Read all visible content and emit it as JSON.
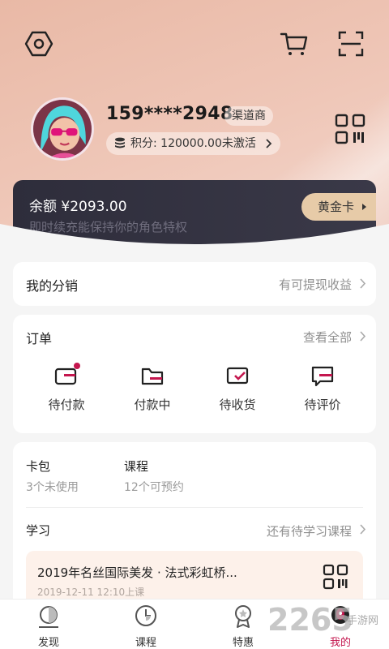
{
  "profile": {
    "phone": "159****2948",
    "badge": "渠道商",
    "points": "积分: 120000.00未激活"
  },
  "balance": {
    "amount": "余额 ¥2093.00",
    "subtitle": "即时续充能保持你的角色特权",
    "level_button": "黄金卡"
  },
  "distribution": {
    "title": "我的分销",
    "action": "有可提现收益"
  },
  "orders": {
    "title": "订单",
    "view_all": "查看全部",
    "items": [
      {
        "label": "待付款",
        "icon": "wallet-icon",
        "has_dot": true
      },
      {
        "label": "付款中",
        "icon": "folder-wallet-icon",
        "has_dot": false
      },
      {
        "label": "待收货",
        "icon": "receive-icon",
        "has_dot": false
      },
      {
        "label": "待评价",
        "icon": "comment-icon",
        "has_dot": false
      }
    ]
  },
  "misc": {
    "card_pack": {
      "title": "卡包",
      "sub": "3个未使用"
    },
    "courses": {
      "title": "课程",
      "sub": "12个可预约"
    },
    "study": {
      "title": "学习",
      "action": "还有待学习课程",
      "item_title": "2019年名丝国际美发 · 法式彩虹桥...",
      "item_time": "2019-12-11 12:10上课"
    }
  },
  "tabbar": {
    "items": [
      {
        "label": "发现",
        "icon": "discover-icon"
      },
      {
        "label": "课程",
        "icon": "clock-icon"
      },
      {
        "label": "特惠",
        "icon": "medal-icon"
      },
      {
        "label": "我的",
        "icon": "profile-icon",
        "active": true
      }
    ]
  },
  "watermark": {
    "number": "2265",
    "text": "手游网"
  },
  "colors": {
    "accent": "#c4164e",
    "gold": "#e7cba8",
    "card_dark": "#2e2d3b",
    "header_peach": "#efc7b8"
  }
}
